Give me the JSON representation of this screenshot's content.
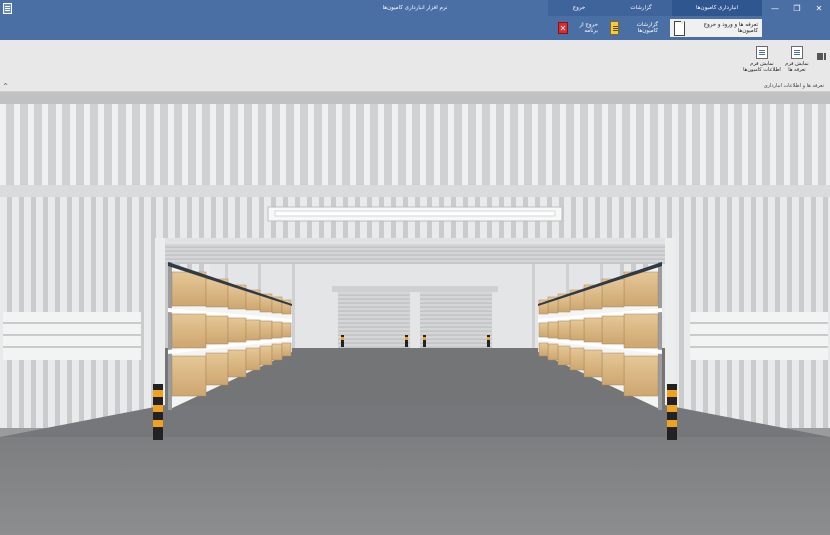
{
  "window": {
    "title": "نرم افزار انبارداری کامیون‌ها",
    "buttons": {
      "close": "✕",
      "restore": "❐",
      "minimize": "—"
    }
  },
  "tabs": [
    {
      "label": "انبارداری کامیون‌ها",
      "active": true
    },
    {
      "label": "گزارشات",
      "active": false
    },
    {
      "label": "خروج",
      "active": false
    }
  ],
  "subtabs": {
    "entry": "تعرفه ها و ورود و خروج کامیون‌ها",
    "reports": "گزارشات کامیون‌ها",
    "exit": "خروج از برنامه"
  },
  "ribbon": {
    "btn_tariff_form": "نمایش فرم تعرفه ها",
    "btn_truck_info_form": "نمایش فرم اطلاعات کامیون‌ها",
    "group_label": "تعرفه ها و اطلاعات انبارداری",
    "collapse": "^"
  },
  "colors": {
    "titlebar": "#4a6fa5",
    "active_tab": "#2f568f",
    "ribbon": "#e8e8e8"
  }
}
